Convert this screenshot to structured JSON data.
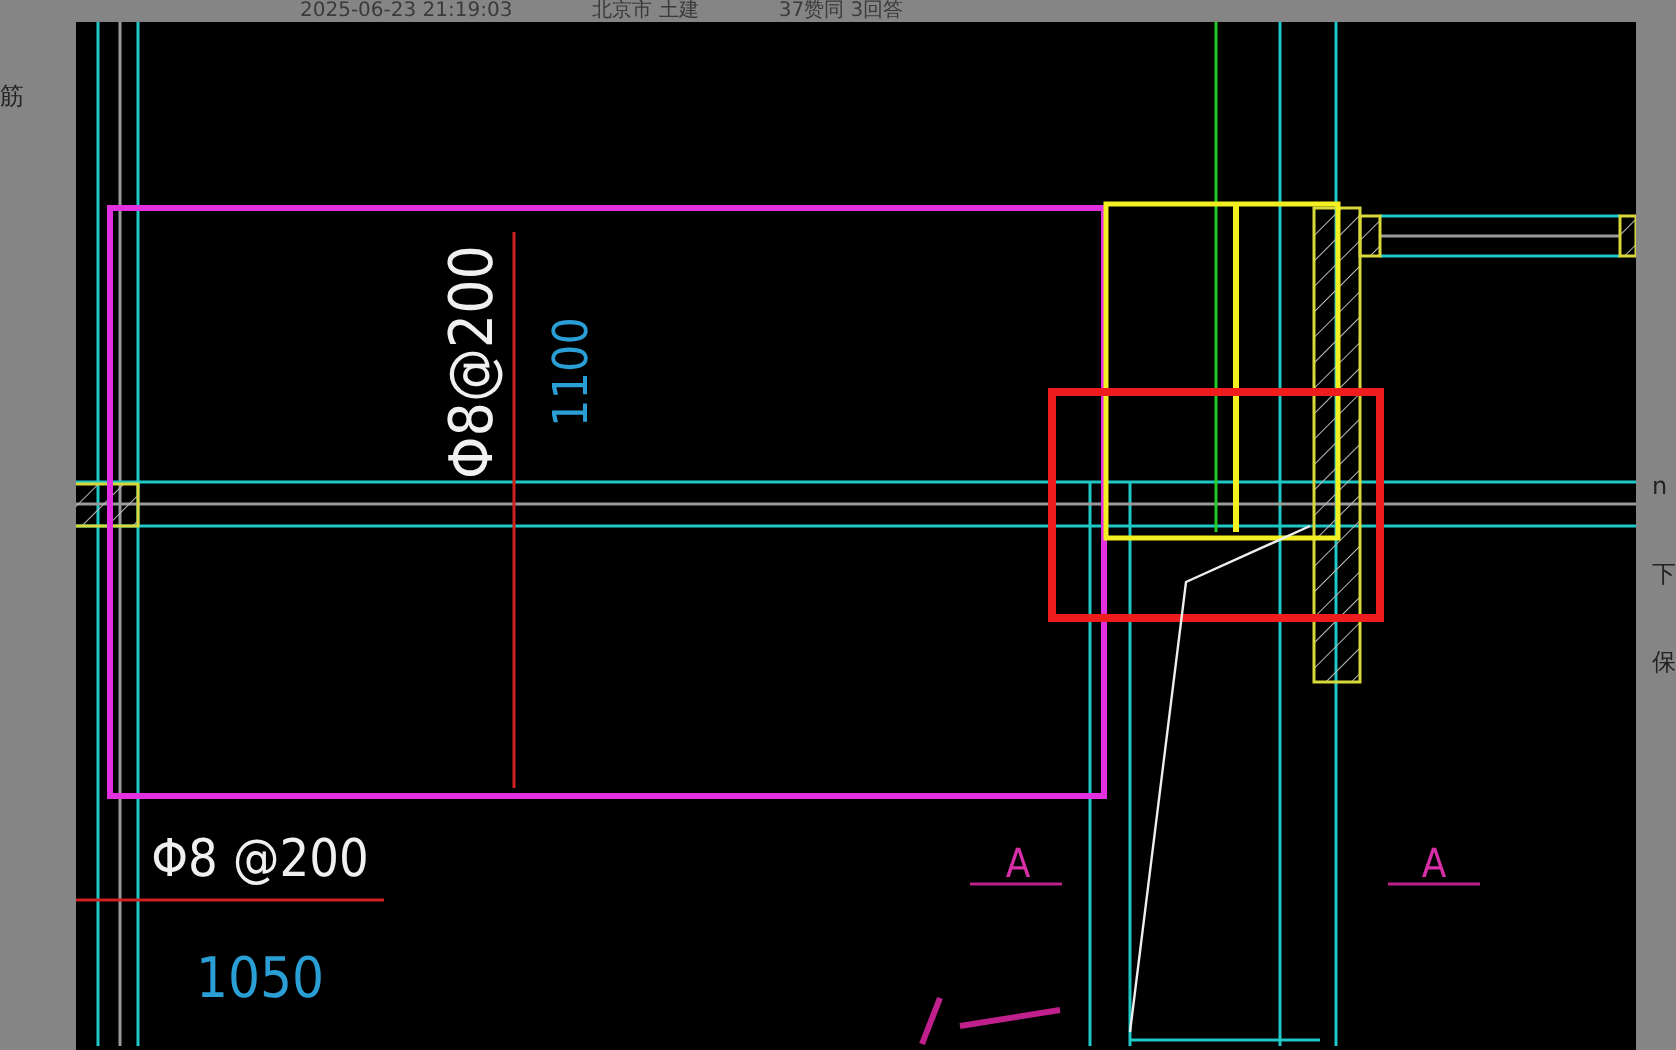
{
  "header": {
    "texts": [
      "2025-06-23 21:19:03",
      "北京市  土建",
      "37赞同  3回答"
    ]
  },
  "left_edge": {
    "texts": [
      "筋"
    ]
  },
  "right_edge": {
    "texts": [
      "n",
      "下",
      "保"
    ]
  },
  "drawing": {
    "labels": [
      {
        "text": "Φ8@200",
        "kind": "rebar"
      },
      {
        "text": "1100",
        "kind": "dimension"
      },
      {
        "text": "Φ8 @200",
        "kind": "rebar"
      },
      {
        "text": "1050",
        "kind": "dimension"
      },
      {
        "text": "A",
        "kind": "section"
      },
      {
        "text": "A",
        "kind": "section"
      }
    ]
  }
}
